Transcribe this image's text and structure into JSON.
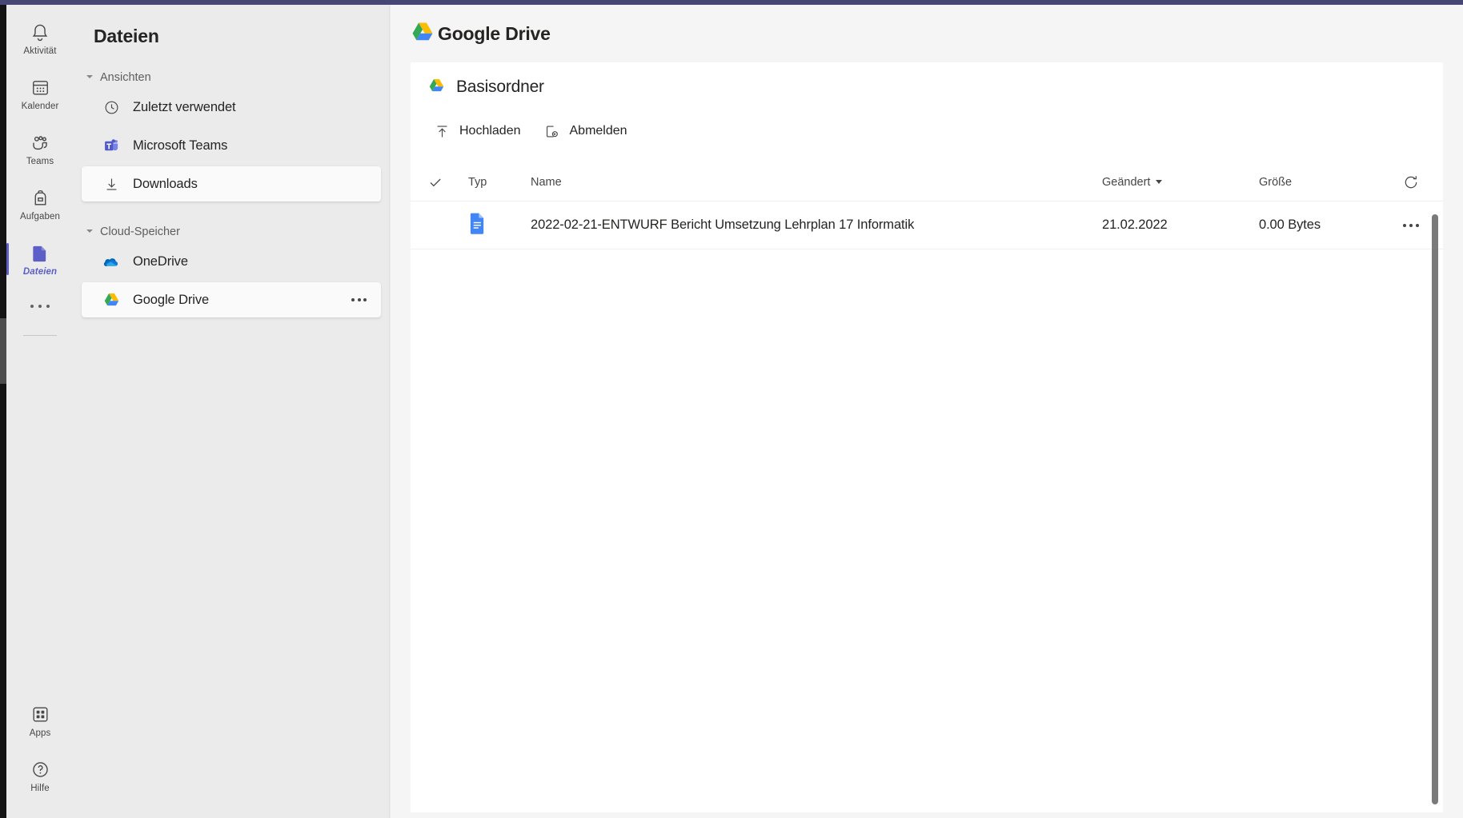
{
  "colors": {
    "accent": "#464775",
    "brand_purple": "#5b5fc7",
    "text": "#252423",
    "muted": "#605e5c"
  },
  "rail": {
    "items": [
      {
        "label": "Aktivität",
        "icon": "bell-icon",
        "active": false
      },
      {
        "label": "Kalender",
        "icon": "calendar-icon",
        "active": false
      },
      {
        "label": "Teams",
        "icon": "teams-people-icon",
        "active": false
      },
      {
        "label": "Aufgaben",
        "icon": "backpack-icon",
        "active": false
      },
      {
        "label": "Dateien",
        "icon": "file-icon",
        "active": true
      }
    ],
    "more_label": "Weitere Apps",
    "bottom_items": [
      {
        "label": "Apps",
        "icon": "apps-grid-icon"
      },
      {
        "label": "Hilfe",
        "icon": "help-question-icon"
      }
    ]
  },
  "sidebar": {
    "title": "Dateien",
    "groups": [
      {
        "label": "Ansichten",
        "items": [
          {
            "label": "Zuletzt verwendet",
            "icon": "clock-icon",
            "selected": false,
            "has_more": false
          },
          {
            "label": "Microsoft Teams",
            "icon": "microsoft-teams-icon",
            "selected": false,
            "has_more": false
          },
          {
            "label": "Downloads",
            "icon": "download-arrow-icon",
            "selected": true,
            "has_more": false
          }
        ]
      },
      {
        "label": "Cloud-Speicher",
        "items": [
          {
            "label": "OneDrive",
            "icon": "onedrive-cloud-icon",
            "selected": false,
            "has_more": false
          },
          {
            "label": "Google Drive",
            "icon": "google-drive-icon",
            "selected": true,
            "has_more": true
          }
        ]
      }
    ]
  },
  "main": {
    "header": {
      "title": "Google Drive",
      "icon": "google-drive-icon"
    },
    "folder": {
      "name": "Basisordner",
      "icon": "google-drive-icon"
    },
    "toolbar": [
      {
        "label": "Hochladen",
        "icon": "upload-arrow-icon"
      },
      {
        "label": "Abmelden",
        "icon": "sign-out-icon"
      }
    ],
    "table": {
      "columns": {
        "select": "",
        "type": "Typ",
        "name": "Name",
        "modified": "Geändert",
        "size": "Größe"
      },
      "sort": {
        "column": "Geändert",
        "direction": "descending"
      },
      "refresh_label": "Aktualisieren",
      "rows": [
        {
          "type_icon": "google-docs-icon",
          "name": "2022-02-21-ENTWURF Bericht Umsetzung Lehrplan 17 Informatik",
          "modified": "21.02.2022",
          "size": "0.00 Bytes",
          "more_label": "Weitere Optionen"
        }
      ]
    }
  }
}
